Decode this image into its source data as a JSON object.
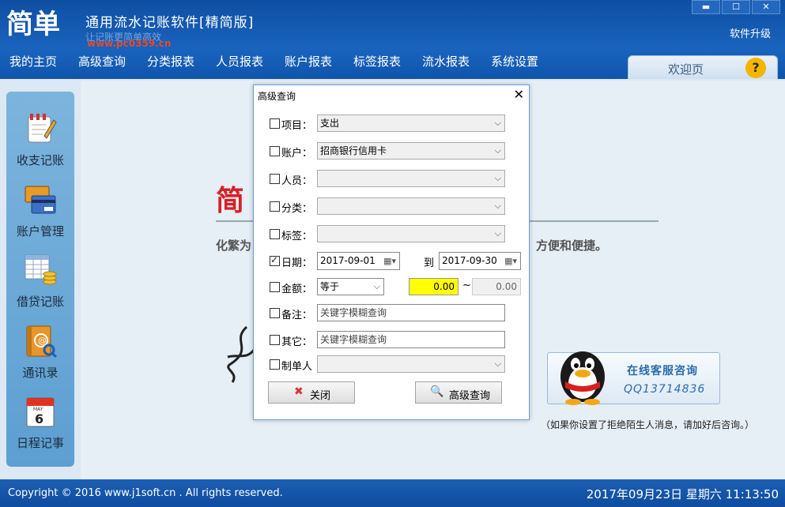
{
  "titlebar": {
    "logo_text": "简单",
    "title": "通用流水记账软件[精简版]",
    "subtitle": "让记账更简单高效",
    "watermark": "www.pc0359.cn",
    "minimize": "▬",
    "maximize": "☐",
    "close": "✕",
    "upgrade": "软件升级"
  },
  "menu": [
    "我的主页",
    "高级查询",
    "分类报表",
    "人员报表",
    "账户报表",
    "标签报表",
    "流水报表",
    "系统设置"
  ],
  "tab": {
    "welcome": "欢迎页",
    "help": "?"
  },
  "sidebar": [
    {
      "label": "收支记账",
      "icon": "notebook-pencil-icon"
    },
    {
      "label": "账户管理",
      "icon": "credit-card-icon"
    },
    {
      "label": "借贷记账",
      "icon": "spreadsheet-coins-icon"
    },
    {
      "label": "通讯录",
      "icon": "address-book-icon"
    },
    {
      "label": "日程记事",
      "icon": "calendar-icon"
    }
  ],
  "calendar_icon": {
    "month": "MAY",
    "day": "6"
  },
  "banner": {
    "char": "简",
    "text_left": "化繁为",
    "text_right": "方便和便捷。"
  },
  "qq": {
    "title": "在线客服咨询",
    "number": "QQ13714836",
    "note": "（如果你设置了拒绝陌生人消息，请加好后咨询。）"
  },
  "footer": {
    "copyright": "Copyright © 2016 www.j1soft.cn . All rights reserved.",
    "datetime": "2017年09月23日  星期六  11:13:50"
  },
  "dialog": {
    "title": "高级查询",
    "close": "✕",
    "project": {
      "label": "项目：",
      "value": "支出",
      "checked": false
    },
    "account": {
      "label": "账户：",
      "value": "招商银行信用卡",
      "checked": false
    },
    "person": {
      "label": "人员：",
      "value": "",
      "checked": false
    },
    "category": {
      "label": "分类：",
      "value": "",
      "checked": false
    },
    "tag": {
      "label": "标签：",
      "value": "",
      "checked": false
    },
    "date": {
      "label": "日期：",
      "from": "2017-09-01",
      "to_label": "到",
      "to": "2017-09-30",
      "checked": true
    },
    "amount": {
      "label": "金额：",
      "op": "等于",
      "min": "0.00",
      "tilde": "~",
      "max": "0.00",
      "checked": false
    },
    "note": {
      "label": "备注：",
      "placeholder": "关键字模糊查询",
      "checked": false
    },
    "other": {
      "label": "其它：",
      "placeholder": "关键字模糊查询",
      "checked": false
    },
    "creator": {
      "label": "制单人",
      "value": "",
      "checked": false
    },
    "close_button": "关闭",
    "query_button": "高级查询"
  },
  "colors": {
    "accent": "#1a63bd",
    "amount_highlight": "#ffff00",
    "close_red": "#d9333f"
  }
}
